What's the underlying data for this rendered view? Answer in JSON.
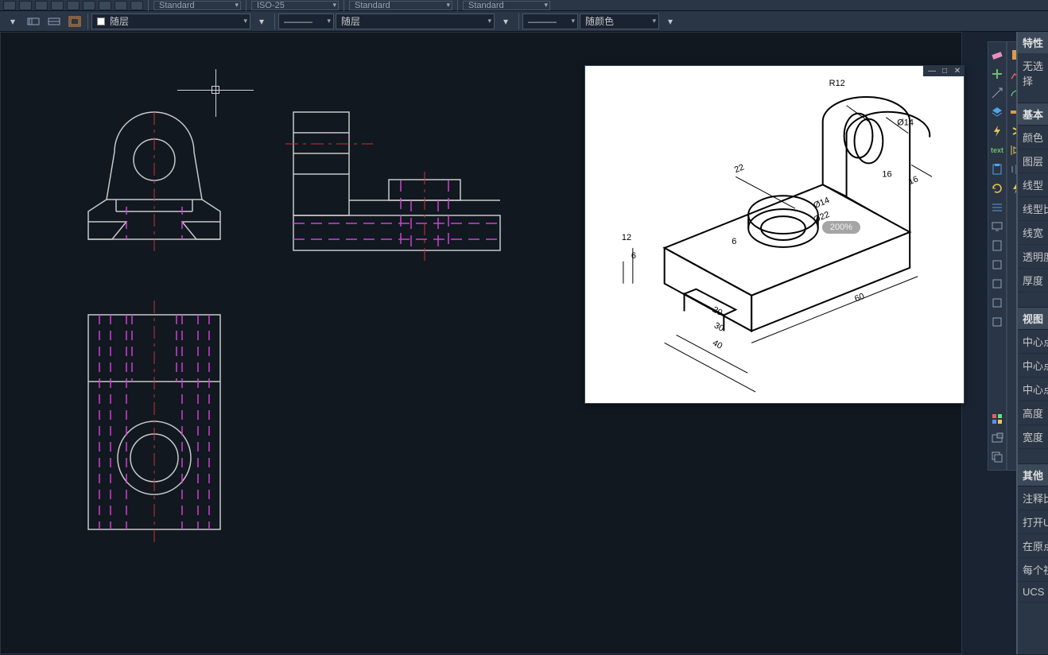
{
  "topBar": {
    "style1": "Standard",
    "style2": "ISO-25",
    "style3": "Standard",
    "style4": "Standard"
  },
  "layerBar": {
    "layerDD1": "随层",
    "layerDD2": "随层",
    "lineDD": "——",
    "colorDD": "随颜色"
  },
  "refImage": {
    "zoom": "200%",
    "dims": {
      "r12": "R12",
      "d14a": "Ø14",
      "d14b": "Ø14",
      "d22": "Ø22",
      "l22": "22",
      "l16_a": "16",
      "l16_b": "16",
      "h12": "12",
      "h6": "6",
      "h6b": "6",
      "l20": "20",
      "l30": "30",
      "l40": "40",
      "l60": "60"
    },
    "controls": {
      "min": "—",
      "max": "□",
      "close": "✕"
    }
  },
  "properties": {
    "title": "特性",
    "noSelection": "无选择",
    "sections": {
      "basic": "基本",
      "view": "视图",
      "other": "其他"
    },
    "basicRows": [
      "颜色",
      "图层",
      "线型",
      "线型比",
      "线宽",
      "透明度",
      "厚度"
    ],
    "viewRows": [
      "中心点",
      "中心点",
      "中心点",
      "高度",
      "宽度"
    ],
    "otherRows": [
      "注释比",
      "打开U",
      "在原点",
      "每个视",
      "UCS"
    ]
  },
  "paletteIcons": [
    "eraser",
    "undo",
    "add",
    "zoom-ext",
    "measure",
    "layers",
    "lightning",
    "text",
    "clipboard",
    "refresh",
    "grid",
    "display",
    "palette",
    "properties"
  ]
}
